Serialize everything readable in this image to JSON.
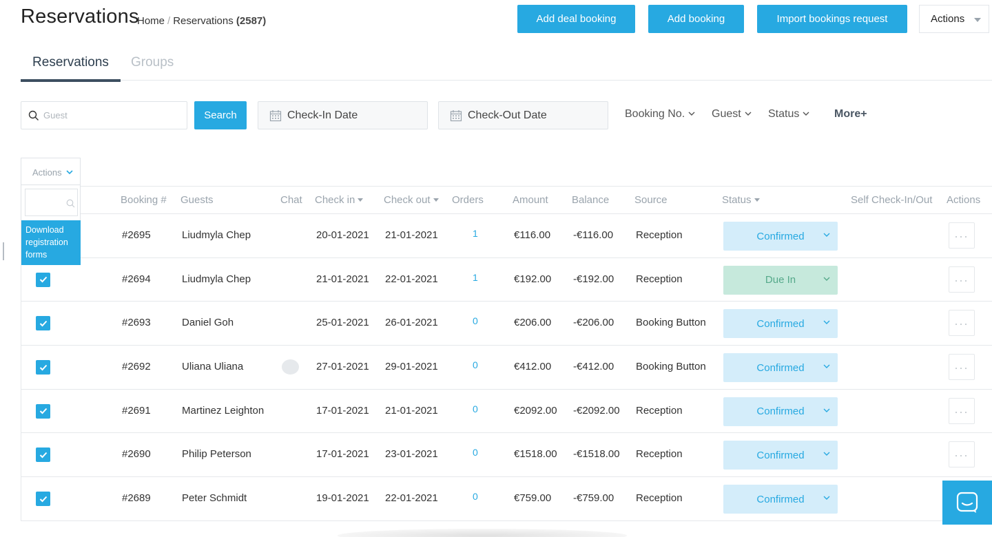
{
  "header": {
    "title": "Reservations",
    "breadcrumb_home": "Home",
    "breadcrumb_sep": "/",
    "breadcrumb_current": "Reservations",
    "breadcrumb_count": "(2587)",
    "buttons": {
      "add_deal_booking": "Add deal booking",
      "add_booking": "Add booking",
      "import_bookings": "Import bookings request",
      "actions": "Actions"
    }
  },
  "tabs": [
    {
      "label": "Reservations",
      "active": true
    },
    {
      "label": "Groups",
      "active": false
    }
  ],
  "filters": {
    "search_placeholder": "Guest",
    "search_button": "Search",
    "check_in": "Check-In Date",
    "check_out": "Check-Out Date",
    "booking_no": "Booking No.",
    "guest": "Guest",
    "status": "Status",
    "more": "More+"
  },
  "bulk_actions": {
    "label": "Actions",
    "menu_item": "Download registration forms"
  },
  "table": {
    "columns": [
      "Booking #",
      "Guests",
      "Chat",
      "Check in",
      "Check out",
      "Orders",
      "Amount",
      "Balance",
      "Source",
      "Status",
      "Self Check-In/Out",
      "Actions"
    ],
    "rows": [
      {
        "checked": false,
        "booking": "#2695",
        "guest": "Liudmyla Chep",
        "chat": false,
        "check_in": "20-01-2021",
        "check_out": "21-01-2021",
        "orders": "1",
        "amount": "€116.00",
        "balance": "-€116.00",
        "source": "Reception",
        "status": "Confirmed"
      },
      {
        "checked": true,
        "booking": "#2694",
        "guest": "Liudmyla Chep",
        "chat": false,
        "check_in": "21-01-2021",
        "check_out": "22-01-2021",
        "orders": "1",
        "amount": "€192.00",
        "balance": "-€192.00",
        "source": "Reception",
        "status": "Due In"
      },
      {
        "checked": true,
        "booking": "#2693",
        "guest": "Daniel Goh",
        "chat": false,
        "check_in": "25-01-2021",
        "check_out": "26-01-2021",
        "orders": "0",
        "amount": "€206.00",
        "balance": "-€206.00",
        "source": "Booking Button",
        "status": "Confirmed"
      },
      {
        "checked": true,
        "booking": "#2692",
        "guest": "Uliana Uliana",
        "chat": true,
        "check_in": "27-01-2021",
        "check_out": "29-01-2021",
        "orders": "0",
        "amount": "€412.00",
        "balance": "-€412.00",
        "source": "Booking Button",
        "status": "Confirmed"
      },
      {
        "checked": true,
        "booking": "#2691",
        "guest": "Martinez Leighton",
        "chat": false,
        "check_in": "17-01-2021",
        "check_out": "21-01-2021",
        "orders": "0",
        "amount": "€2092.00",
        "balance": "-€2092.00",
        "source": "Reception",
        "status": "Confirmed"
      },
      {
        "checked": true,
        "booking": "#2690",
        "guest": "Philip Peterson",
        "chat": false,
        "check_in": "17-01-2021",
        "check_out": "23-01-2021",
        "orders": "0",
        "amount": "€1518.00",
        "balance": "-€1518.00",
        "source": "Reception",
        "status": "Confirmed"
      },
      {
        "checked": true,
        "booking": "#2689",
        "guest": "Peter Schmidt",
        "chat": false,
        "check_in": "19-01-2021",
        "check_out": "22-01-2021",
        "orders": "0",
        "amount": "€759.00",
        "balance": "-€759.00",
        "source": "Reception",
        "status": "Confirmed"
      }
    ]
  },
  "colors": {
    "accent": "#27a9e1",
    "confirmed_bg": "#d4edfa",
    "due_in_bg": "#c6e9dc",
    "due_in_text": "#55a98a"
  },
  "icons": [
    "search-icon",
    "calendar-icon",
    "chevron-down-icon",
    "check-icon",
    "more-dots-icon",
    "chat-icon",
    "messenger-icon"
  ]
}
